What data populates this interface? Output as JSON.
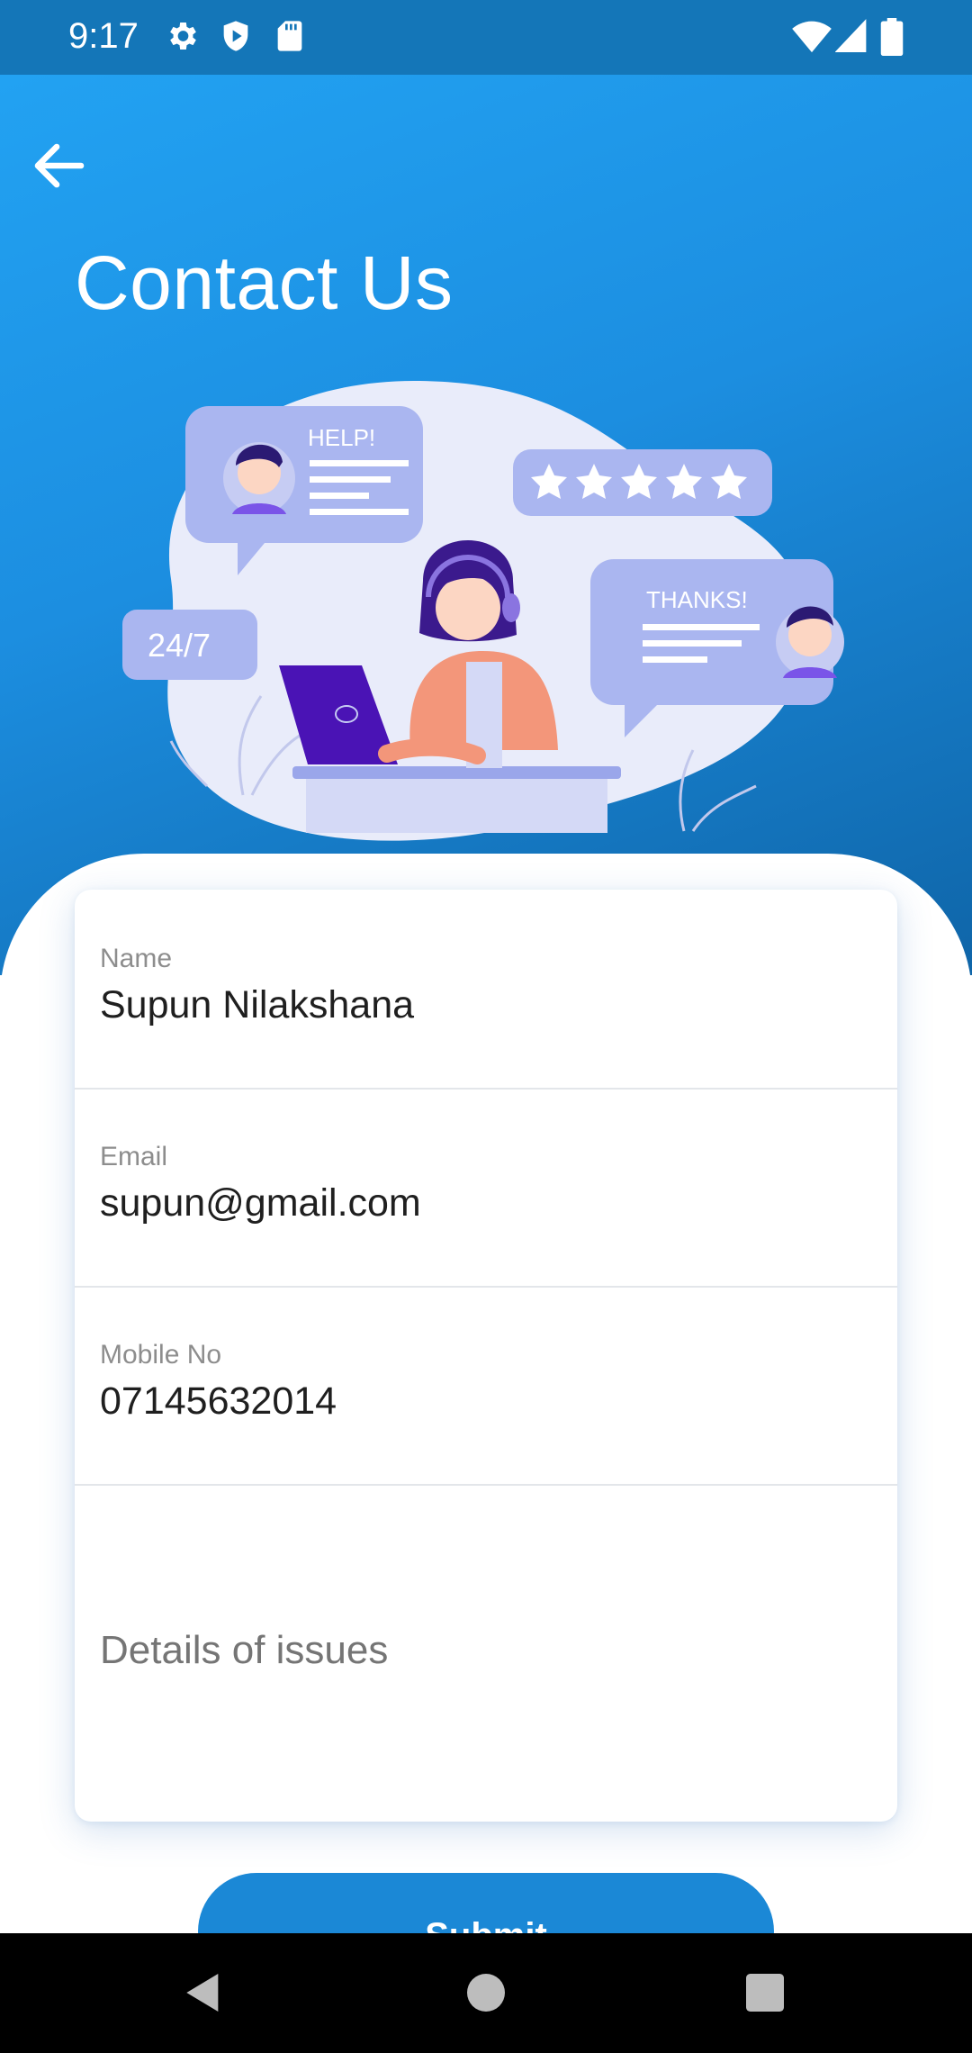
{
  "status_bar": {
    "time": "9:17",
    "left_icons": [
      "gear-icon",
      "shield-play-icon",
      "sd-card-icon"
    ],
    "right_icons": [
      "wifi-icon",
      "signal-icon",
      "battery-icon"
    ]
  },
  "header": {
    "back_icon": "arrow-left-icon",
    "title": "Contact Us"
  },
  "illustration": {
    "help_bubble": "HELP!",
    "thanks_bubble": "THANKS!",
    "badge_247": "24/7",
    "rating_stars": 5
  },
  "form": {
    "name_label": "Name",
    "name_value": "Supun Nilakshana",
    "email_label": "Email",
    "email_value": "supun@gmail.com",
    "mobile_label": "Mobile No",
    "mobile_value": "07145632014",
    "issues_placeholder": "Details of issues"
  },
  "submit_label": "Submit",
  "colors": {
    "accent": "#1b88d6",
    "hero_top": "#22a2f2",
    "hero_bottom": "#0f65a8",
    "status_bar": "#1476b8"
  },
  "nav_bar": {
    "buttons": [
      "back-triangle-icon",
      "home-circle-icon",
      "recents-square-icon"
    ]
  }
}
